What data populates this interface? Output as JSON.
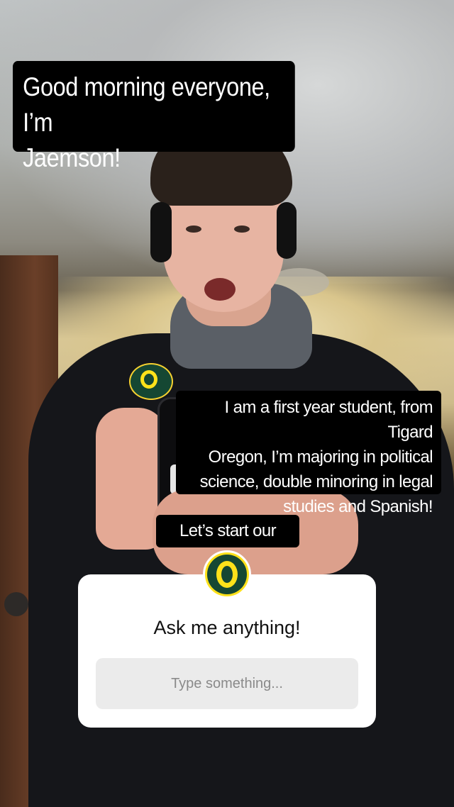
{
  "story": {
    "captions": {
      "greeting_line1": "Good morning everyone, I’m",
      "greeting_line2": "Jaemson!",
      "intro_lines": [
        "I am a first year student, from Tigard",
        "Oregon, I’m majoring in political",
        "science, double minoring in legal",
        "studies and Spanish!"
      ],
      "closing": "Let’s start our day!"
    },
    "question_sticker": {
      "title": "Ask me anything!",
      "placeholder": "Type something...",
      "avatar_icon": "oregon-o-logo-icon"
    }
  },
  "colors": {
    "oregon_green": "#154733",
    "oregon_yellow": "#fee11a",
    "caption_bg": "#000000",
    "caption_text": "#ffffff"
  }
}
